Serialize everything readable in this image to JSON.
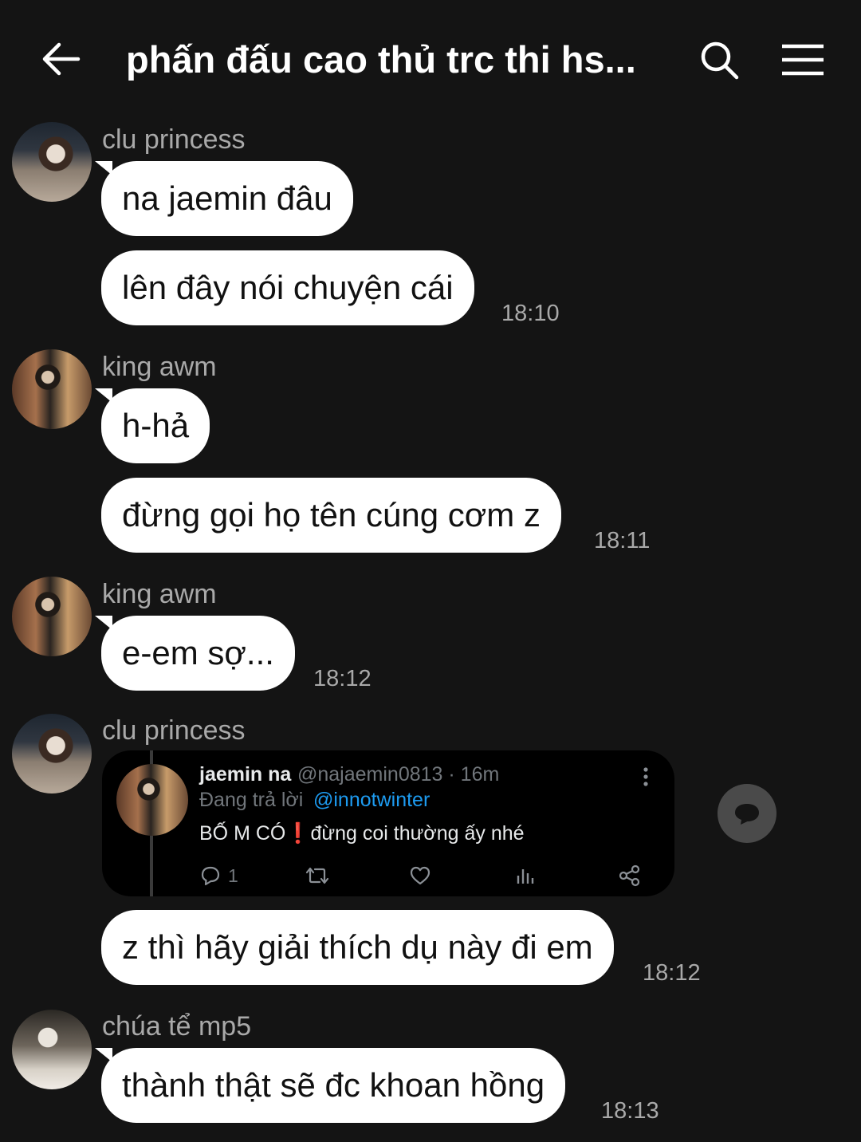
{
  "header": {
    "title": "phấn đấu cao thủ trc thi hs..."
  },
  "messages": [
    {
      "sender": "clu princess",
      "bubbles": [
        "na jaemin đâu",
        "lên đây nói chuyện cái"
      ],
      "time": "18:10"
    },
    {
      "sender": "king awm",
      "bubbles": [
        "h-hả",
        "đừng gọi họ tên cúng cơm z"
      ],
      "time": "18:11"
    },
    {
      "sender": "king awm",
      "bubbles": [
        "e-em sợ..."
      ],
      "time": "18:12"
    },
    {
      "sender": "clu princess",
      "bubbles": [
        "z thì hãy giải thích dụ này đi em"
      ],
      "time": "18:12"
    },
    {
      "sender": "chúa tể mp5",
      "bubbles": [
        "thành thật sẽ đc khoan hồng"
      ],
      "time": "18:13"
    }
  ],
  "tweet": {
    "name": "jaemin na",
    "handle_meta": "@najaemin0813 · 16m",
    "reply_prefix": "Đang trả lời",
    "reply_mention": "@innotwinter",
    "text_before": "BỐ M CÓ",
    "text_emoji": "❗",
    "text_after": "đừng coi thường ấy nhé",
    "reply_count": "1"
  },
  "icons": {
    "back": "arrow-left-icon",
    "search": "search-icon",
    "menu": "hamburger-menu-icon",
    "comment": "comment-bubble-icon"
  },
  "colors": {
    "background": "#141414",
    "bubble": "#ffffff",
    "meta_text": "#a9a9a9",
    "link": "#1d9bf0"
  }
}
